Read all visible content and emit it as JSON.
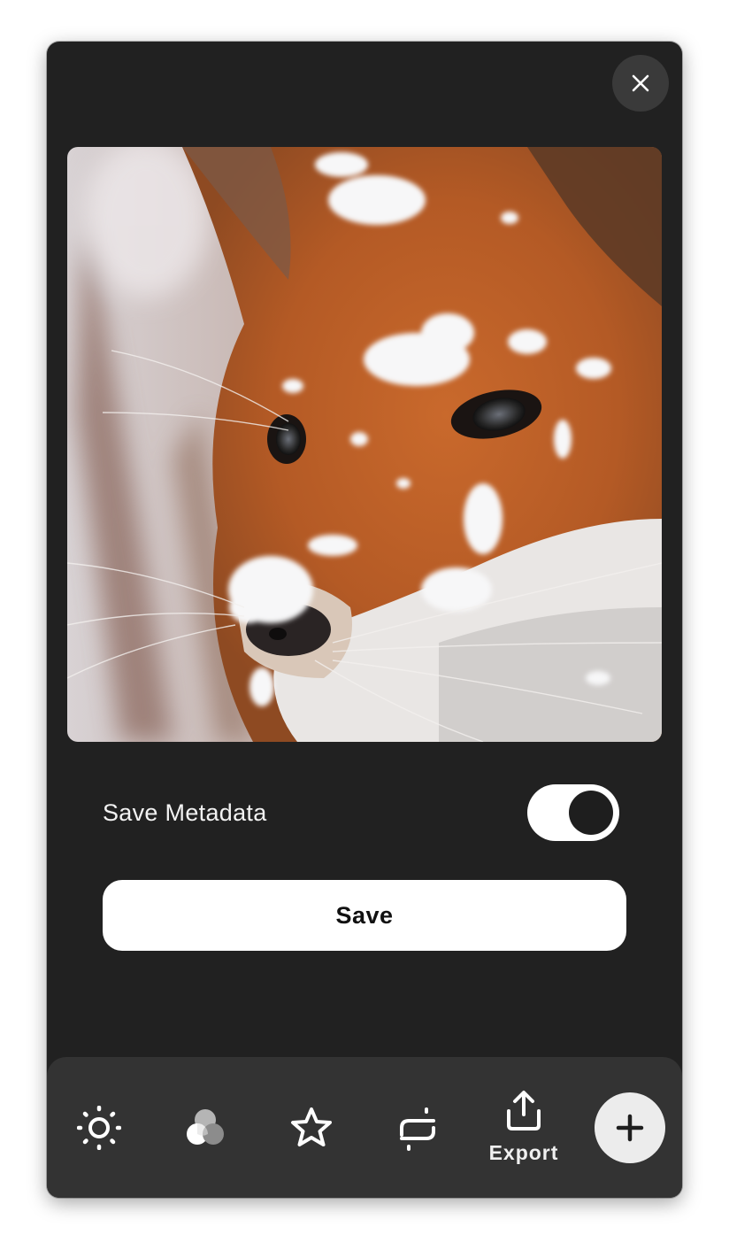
{
  "dialog": {
    "close_icon": "close-icon",
    "photo_subject": "red-fox-in-snow"
  },
  "metadata": {
    "label": "Save Metadata",
    "enabled": true
  },
  "save": {
    "label": "Save"
  },
  "toolbar": {
    "tools": [
      {
        "icon": "brightness-icon"
      },
      {
        "icon": "color-filters-icon"
      },
      {
        "icon": "star-icon"
      },
      {
        "icon": "adjust-icon"
      },
      {
        "icon": "export-icon",
        "label": "Export"
      }
    ],
    "add_icon": "plus-icon"
  },
  "colors": {
    "panel": "#212121",
    "toolbar": "#333333",
    "button": "#ffffff",
    "fab": "#ececec"
  }
}
